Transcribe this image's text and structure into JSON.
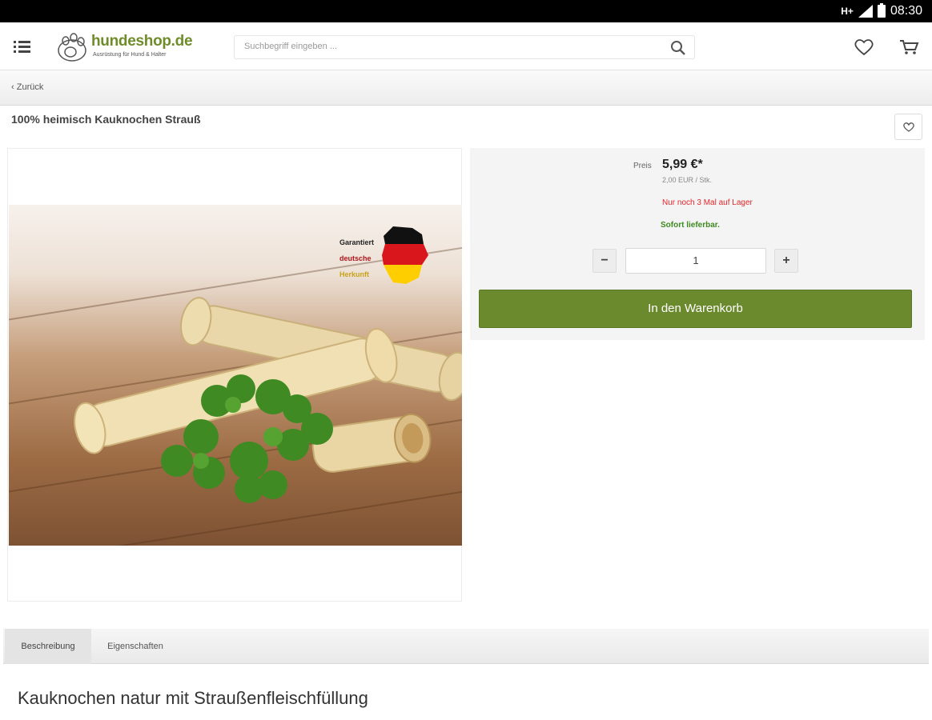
{
  "status_bar": {
    "network": "H+",
    "time": "08:30"
  },
  "header": {
    "brand": "hundeshop.de",
    "tagline": "Ausrüstung für Hund & Halter",
    "search_placeholder": "Suchbegriff eingeben ...",
    "icons": {
      "menu": "menu-icon",
      "search": "search-icon",
      "wishlist": "heart-icon",
      "cart": "cart-icon"
    }
  },
  "nav": {
    "back_label": "Zurück"
  },
  "product": {
    "title": "100% heimisch Kauknochen Strauß",
    "image_badge": [
      "Garantiert",
      "deutsche",
      "Herkunft"
    ],
    "price_label": "Preis",
    "price": "5,99 €*",
    "unit_price": "2,00 EUR / Stk.",
    "stock_warning": "Nur noch 3 Mal auf Lager",
    "delivery": "Sofort lieferbar.",
    "quantity": "1",
    "qty_minus": "−",
    "qty_plus": "+",
    "add_to_cart": "In den Warenkorb"
  },
  "tabs": [
    {
      "label": "Beschreibung",
      "active": true
    },
    {
      "label": "Eigenschaften",
      "active": false
    }
  ],
  "description": {
    "heading": "Kauknochen natur mit Straußenfleischfüllung"
  },
  "colors": {
    "brand_green": "#6b8a2e",
    "stock_red": "#e3262b",
    "delivery_green": "#3f8a22"
  }
}
